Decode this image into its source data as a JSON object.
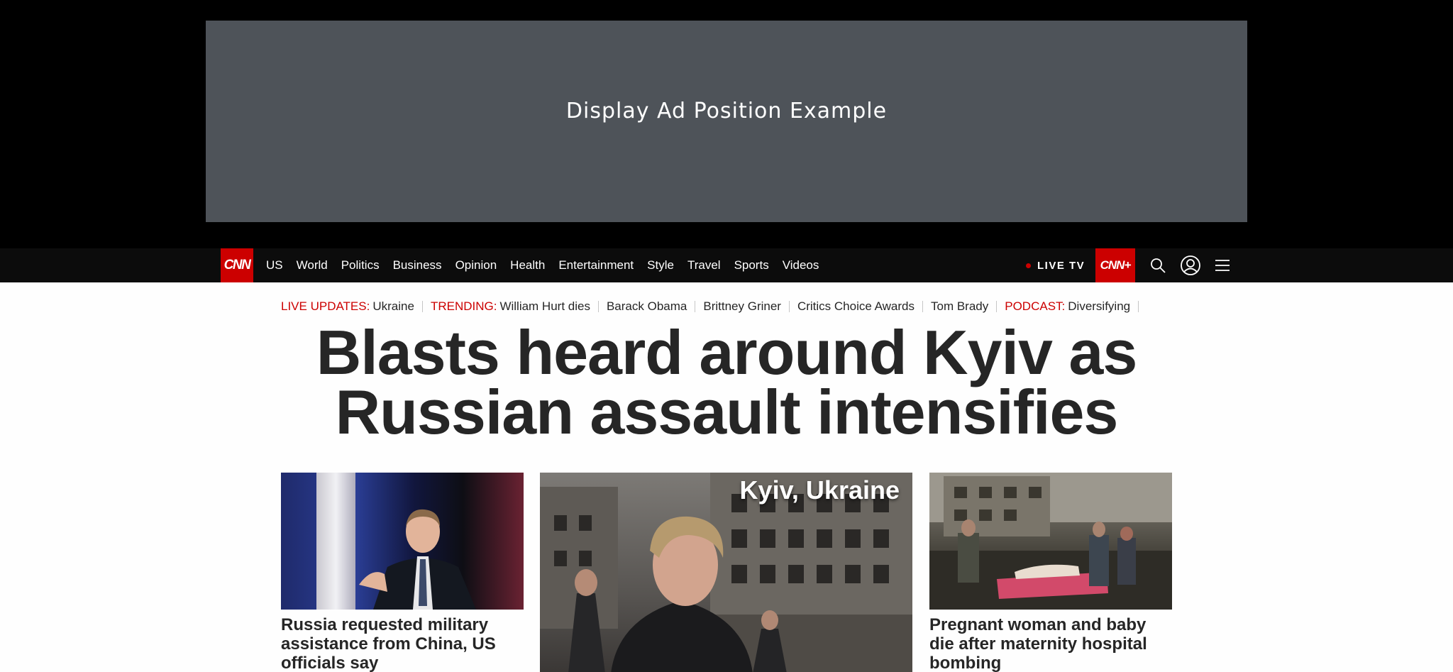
{
  "ad": {
    "label": "Display Ad Position Example"
  },
  "nav": {
    "logo": "CNN",
    "links": [
      "US",
      "World",
      "Politics",
      "Business",
      "Opinion",
      "Health",
      "Entertainment",
      "Style",
      "Travel",
      "Sports",
      "Videos"
    ],
    "live_tv": "LIVE TV",
    "plus": "CNN+",
    "icons": [
      "search-icon",
      "account-icon",
      "menu-icon"
    ]
  },
  "trending": [
    {
      "label": "LIVE UPDATES:",
      "text": "Ukraine"
    },
    {
      "label": "TRENDING:",
      "text": "William Hurt dies"
    },
    {
      "label": "",
      "text": "Barack Obama"
    },
    {
      "label": "",
      "text": "Brittney Griner"
    },
    {
      "label": "",
      "text": "Critics Choice Awards"
    },
    {
      "label": "",
      "text": "Tom Brady"
    },
    {
      "label": "PODCAST:",
      "text": "Diversifying"
    }
  ],
  "headline": "Blasts heard around Kyiv as Russian assault intensifies",
  "cards": [
    {
      "title": "Russia requested military assistance from China, US officials say"
    },
    {
      "overlay": "Kyiv, Ukraine"
    },
    {
      "title": "Pregnant woman and baby die after maternity hospital bombing"
    }
  ],
  "colors": {
    "brand_red": "#cc0000",
    "nav_bg": "#0c0c0c",
    "ad_bg": "#4e5359",
    "text": "#262626"
  }
}
